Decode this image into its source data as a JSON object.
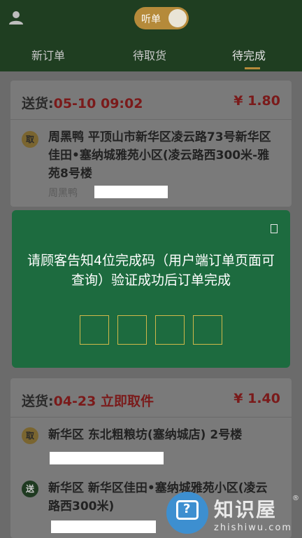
{
  "header": {
    "toggle_label": "听单",
    "tabs": [
      {
        "label": "新订单"
      },
      {
        "label": "待取货"
      },
      {
        "label": "待完成"
      }
    ]
  },
  "orders": [
    {
      "delivery_prefix": "送货:",
      "delivery_time": "05-10 09:02",
      "price": "¥ 1.80",
      "pickup_badge": "取",
      "pickup_address": "周黑鸭 平顶山市新华区凌云路73号新华区佳田•塞纳城雅苑小区(凌云路西300米-雅苑8号楼",
      "pickup_sub": "周黑鸭"
    },
    {
      "delivery_prefix": "送货:",
      "delivery_time": "04-23 立即取件",
      "price": "¥ 1.40",
      "pickup_badge": "取",
      "pickup_address": "新华区 东北粗粮坊(塞纳城店) 2号楼",
      "dropoff_badge": "送",
      "dropoff_address": "新华区 新华区佳田•塞纳城雅苑小区(凌云路西300米)"
    }
  ],
  "dialog": {
    "message": "请顾客告知4位完成码（用户端订单页面可查询）验证成功后订单完成"
  },
  "watermark": {
    "cn": "知识屋",
    "en": "zhishiwu.com",
    "reg": "®",
    "badge_glyph": "?"
  },
  "colors": {
    "header_bg": "#1f3e21",
    "accent_gold": "#b58a3a",
    "dialog_green": "#1d6b3f",
    "price_red": "#7a1a1a"
  }
}
